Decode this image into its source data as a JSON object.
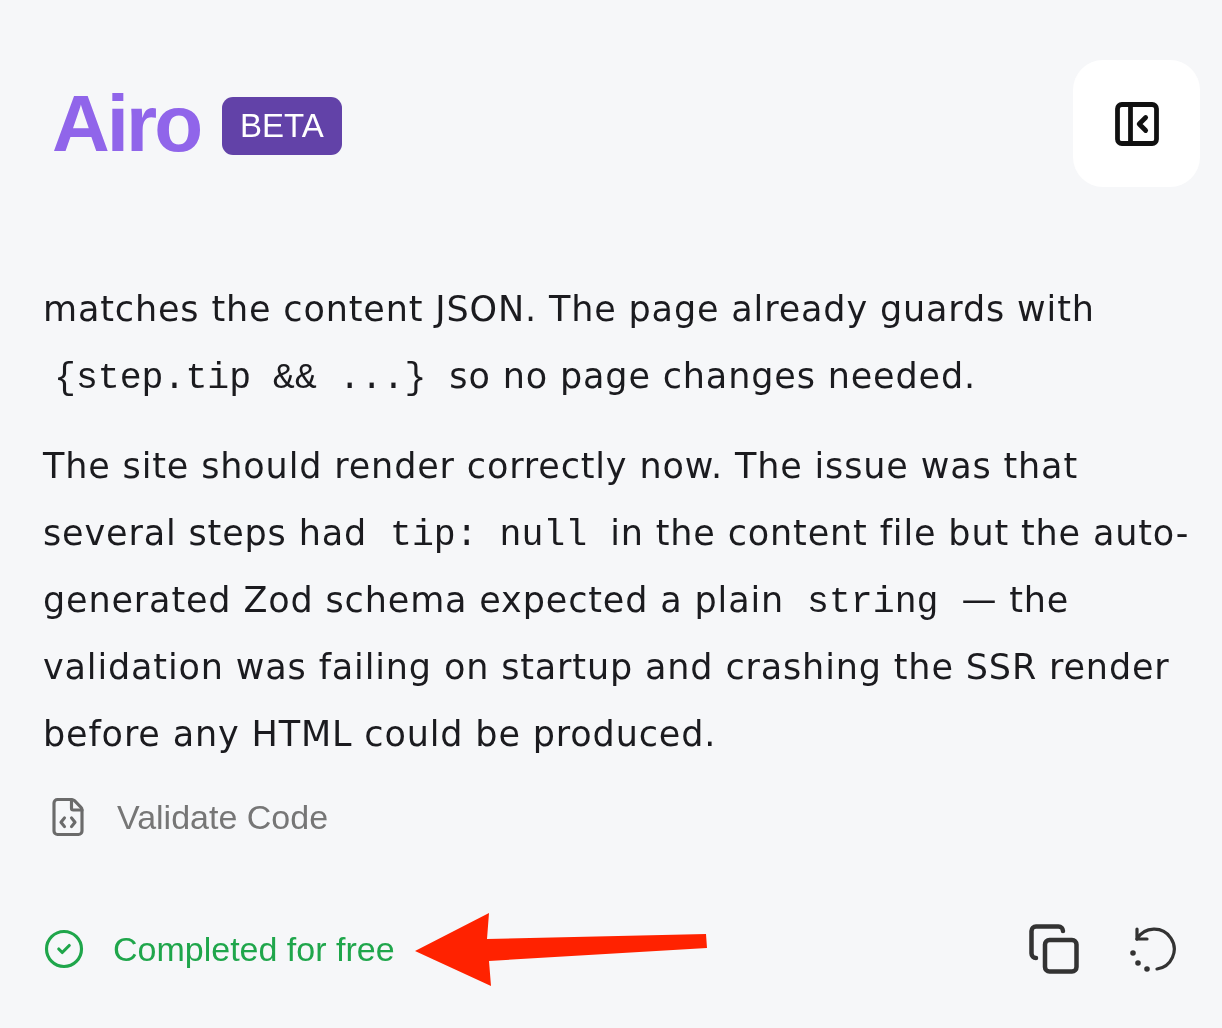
{
  "header": {
    "logo": "Airo",
    "badge": "BETA"
  },
  "message": {
    "paragraphs": [
      {
        "segments": [
          {
            "kind": "text",
            "text": "matches the content JSON. The page already guards with "
          },
          {
            "kind": "code",
            "text": "{step.tip && ...}"
          },
          {
            "kind": "text",
            "text": " so no page changes needed."
          }
        ]
      },
      {
        "segments": [
          {
            "kind": "text",
            "text": "The site should render correctly now. The issue was that several steps had "
          },
          {
            "kind": "code",
            "text": "tip: null"
          },
          {
            "kind": "text",
            "text": " in the content file but the auto-generated Zod schema expected a plain "
          },
          {
            "kind": "code",
            "text": "string"
          },
          {
            "kind": "text",
            "text": " — the validation was failing on startup and crashing the SSR render before any HTML could be produced."
          }
        ]
      }
    ]
  },
  "tool_step": {
    "label": "Validate Code"
  },
  "status": {
    "label": "Completed for free",
    "success": true
  },
  "annotation": {
    "kind": "arrow"
  }
}
